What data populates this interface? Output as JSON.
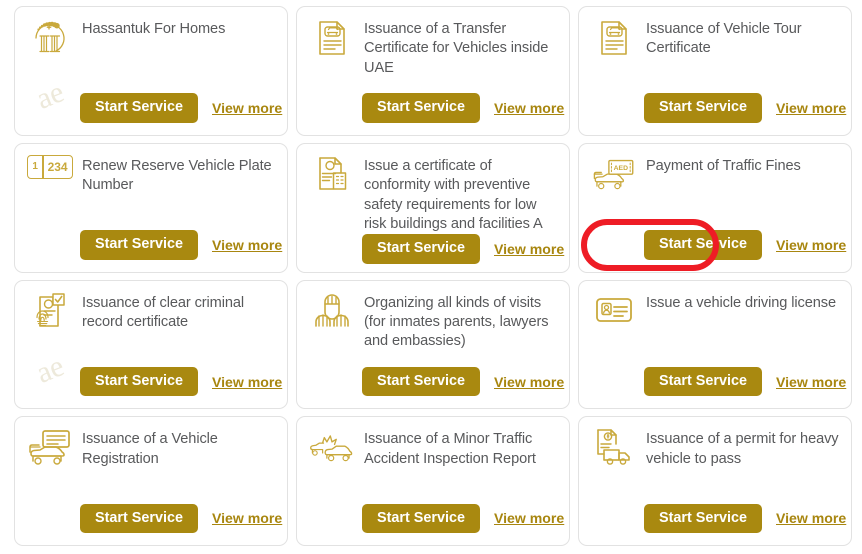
{
  "theme": {
    "button_color": "#a98910",
    "link_color": "#a8860f",
    "icon_color": "#c9a93c",
    "title_color": "#58595b",
    "card_border": "#e2e2e2",
    "highlight_ring_color": "#ee1c25",
    "page_background": "#ffffff"
  },
  "labels": {
    "start_service": "Start Service",
    "view_more": "View more",
    "watermark": "ae"
  },
  "cards": [
    {
      "id": "hassantuk-for-homes",
      "title": "Hassantuk For Homes",
      "icon": "hassantuk-columns-icon",
      "start_label": "Start Service",
      "view_label": "View more",
      "highlighted": false,
      "watermark": true
    },
    {
      "id": "transfer-certificate-vehicles-uae",
      "title": "Issuance of a Transfer Certificate for Vehicles inside UAE",
      "icon": "vehicle-document-icon",
      "start_label": "Start Service",
      "view_label": "View more",
      "highlighted": false,
      "watermark": false
    },
    {
      "id": "vehicle-tour-certificate",
      "title": "Issuance of Vehicle Tour Certificate",
      "icon": "vehicle-document-icon",
      "start_label": "Start Service",
      "view_label": "View more",
      "highlighted": false,
      "watermark": false
    },
    {
      "id": "renew-reserve-vehicle-plate-number",
      "title": "Renew Reserve Vehicle Plate Number",
      "icon": "license-plate-icon",
      "plate_code": "1",
      "plate_number": "234",
      "start_label": "Start Service",
      "view_label": "View more",
      "highlighted": false,
      "watermark": false
    },
    {
      "id": "certificate-of-conformity-preventive-safety",
      "title": "Issue a certificate of conformity with preventive safety requirements for low risk buildings and facilities A",
      "icon": "safety-certificate-building-icon",
      "start_label": "Start Service",
      "view_label": "View more",
      "highlighted": false,
      "watermark": false
    },
    {
      "id": "payment-of-traffic-fines",
      "title": "Payment of Traffic Fines",
      "icon": "car-banknote-aed-icon",
      "currency_label": "AED",
      "start_label": "Start Service",
      "view_label": "View more",
      "highlighted": true,
      "watermark": false
    },
    {
      "id": "clear-criminal-record-certificate",
      "title": "Issuance of clear criminal record certificate",
      "icon": "fingerprint-document-icon",
      "start_label": "Start Service",
      "view_label": "View more",
      "highlighted": false,
      "watermark": true
    },
    {
      "id": "organizing-visits",
      "title": "Organizing all kinds of visits (for inmates parents, lawyers and embassies)",
      "icon": "prison-visit-icon",
      "start_label": "Start Service",
      "view_label": "View more",
      "highlighted": false,
      "watermark": false
    },
    {
      "id": "vehicle-driving-license",
      "title": "Issue a vehicle driving license",
      "icon": "id-card-icon",
      "start_label": "Start Service",
      "view_label": "View more",
      "highlighted": false,
      "watermark": false
    },
    {
      "id": "vehicle-registration",
      "title": "Issuance of a Vehicle Registration",
      "icon": "car-card-icon",
      "start_label": "Start Service",
      "view_label": "View more",
      "highlighted": false,
      "watermark": false
    },
    {
      "id": "minor-traffic-accident-inspection-report",
      "title": "Issuance of a Minor Traffic Accident Inspection Report",
      "icon": "car-collision-icon",
      "start_label": "Start Service",
      "view_label": "View more",
      "highlighted": false,
      "watermark": false
    },
    {
      "id": "permit-heavy-vehicle-to-pass",
      "title": "Issuance of a permit for heavy vehicle to pass",
      "icon": "truck-permit-icon",
      "start_label": "Start Service",
      "view_label": "View more",
      "highlighted": false,
      "watermark": false
    }
  ]
}
